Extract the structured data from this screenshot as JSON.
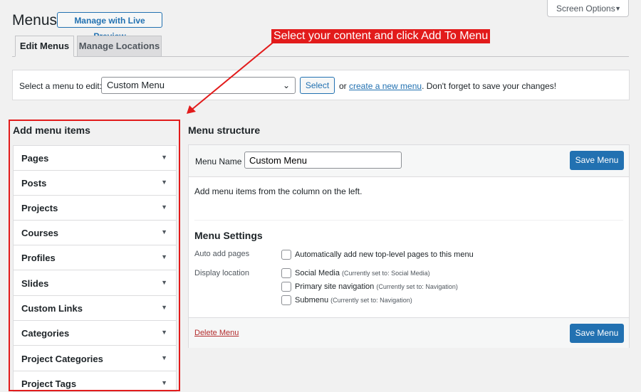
{
  "header": {
    "title": "Menus",
    "live_preview_label": "Manage with Live Preview",
    "screen_options_label": "Screen Options"
  },
  "tabs": [
    {
      "label": "Edit Menus",
      "active": true
    },
    {
      "label": "Manage Locations",
      "active": false
    }
  ],
  "select_bar": {
    "label": "Select a menu to edit:",
    "selected": "Custom Menu",
    "button": "Select",
    "or_text": "or",
    "create_link": "create a new menu",
    "save_hint": ". Don't forget to save your changes!"
  },
  "add_items": {
    "title": "Add menu items",
    "items": [
      "Pages",
      "Posts",
      "Projects",
      "Courses",
      "Profiles",
      "Slides",
      "Custom Links",
      "Categories",
      "Project Categories",
      "Project Tags"
    ]
  },
  "structure": {
    "title": "Menu structure",
    "name_label": "Menu Name",
    "name_value": "Custom Menu",
    "save_label": "Save Menu",
    "instructions": "Add menu items from the column on the left.",
    "settings_title": "Menu Settings",
    "auto_add_label": "Auto add pages",
    "auto_add_text": "Automatically add new top-level pages to this menu",
    "display_location_label": "Display location",
    "locations": [
      {
        "name": "Social Media",
        "note": "(Currently set to: Social Media)"
      },
      {
        "name": "Primary site navigation",
        "note": "(Currently set to: Navigation)"
      },
      {
        "name": "Submenu",
        "note": "(Currently set to: Navigation)"
      }
    ],
    "delete_label": "Delete Menu"
  },
  "annotation": {
    "text": "Select your content and click Add To Menu",
    "color": "#e21b1b"
  },
  "colors": {
    "accent": "#2271b1",
    "danger": "#b32d2e",
    "background": "#f1f1f1"
  }
}
